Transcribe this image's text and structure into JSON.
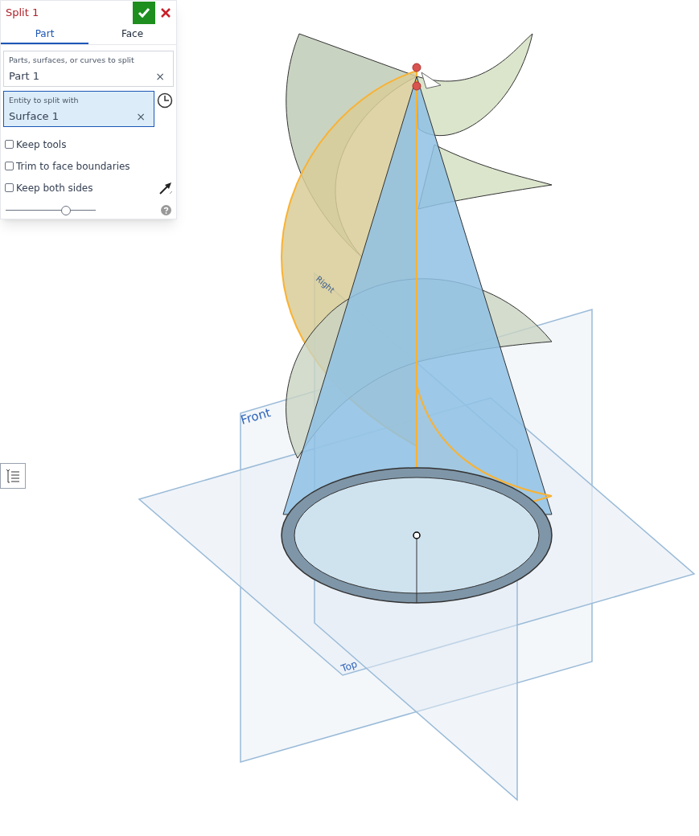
{
  "dialog": {
    "title": "Split 1",
    "tabs": [
      {
        "label": "Part",
        "selected": true
      },
      {
        "label": "Face",
        "selected": false
      }
    ],
    "fields": [
      {
        "label": "Parts, surfaces, or curves to split",
        "value": "Part 1",
        "clear": "×",
        "selected": false
      },
      {
        "label": "Entity to split with",
        "value": "Surface 1",
        "clear": "×",
        "selected": true
      }
    ],
    "checkboxes": [
      {
        "label": "Keep tools",
        "checked": false
      },
      {
        "label": "Trim to face boundaries",
        "checked": false
      },
      {
        "label": "Keep both sides",
        "checked": false
      }
    ],
    "slider": {
      "level": 0.69
    }
  },
  "viewport": {
    "planes": [
      {
        "label": "Right"
      },
      {
        "label": "Front"
      },
      {
        "label": "Top"
      }
    ]
  }
}
